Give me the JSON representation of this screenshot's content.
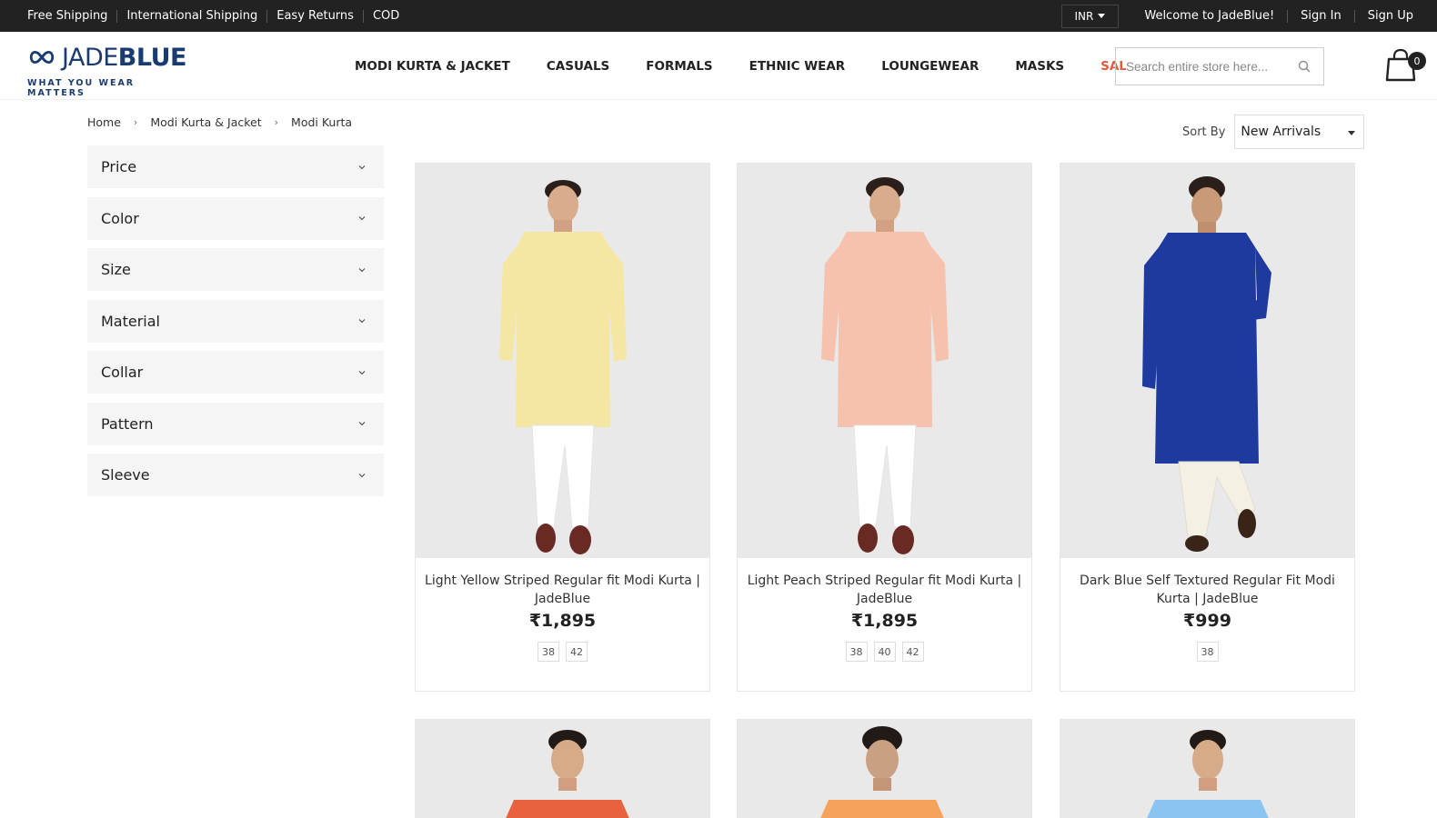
{
  "topbar": {
    "links": [
      "Free Shipping",
      "International Shipping",
      "Easy Returns",
      "COD"
    ],
    "currency": "INR",
    "welcome": "Welcome to JadeBlue!",
    "sign_in": "Sign In",
    "sign_up": "Sign Up"
  },
  "logo": {
    "jade": "JADE",
    "blue": "BLUE",
    "tagline": "WHAT YOU WEAR MATTERS"
  },
  "nav": {
    "items": [
      "MODI KURTA & JACKET",
      "CASUALS",
      "FORMALS",
      "ETHNIC WEAR",
      "LOUNGEWEAR",
      "MASKS",
      "SALE"
    ]
  },
  "search": {
    "placeholder": "Search entire store here..."
  },
  "cart": {
    "count": "0"
  },
  "breadcrumb": {
    "items": [
      "Home",
      "Modi Kurta & Jacket",
      "Modi Kurta"
    ]
  },
  "sort": {
    "label": "Sort By",
    "selected": "New Arrivals"
  },
  "filters": [
    "Price",
    "Color",
    "Size",
    "Material",
    "Collar",
    "Pattern",
    "Sleeve"
  ],
  "products": [
    {
      "name": "Light Yellow Striped Regular fit Modi Kurta | JadeBlue",
      "price": "₹1,895",
      "sizes": [
        "38",
        "42"
      ],
      "kurta_color": "#f6e6a4",
      "bottom_color": "#ffffff"
    },
    {
      "name": "Light Peach Striped Regular fit Modi Kurta | JadeBlue",
      "price": "₹1,895",
      "sizes": [
        "38",
        "40",
        "42"
      ],
      "kurta_color": "#f6c2ae",
      "bottom_color": "#ffffff"
    },
    {
      "name": "Dark Blue Self Textured Regular Fit Modi Kurta | JadeBlue",
      "price": "₹999",
      "sizes": [
        "38"
      ],
      "kurta_color": "#1f3a9e",
      "bottom_color": "#f4f0e4"
    }
  ],
  "products_row2": [
    {
      "kurta_color": "#e8623f"
    },
    {
      "kurta_color": "#f7a25a"
    },
    {
      "kurta_color": "#8cc4f0"
    }
  ],
  "colors": {
    "topbar_bg": "#222222",
    "brand_blue": "#1a3b70",
    "sale": "#e8573f",
    "filter_bg": "#f5f5f5"
  }
}
